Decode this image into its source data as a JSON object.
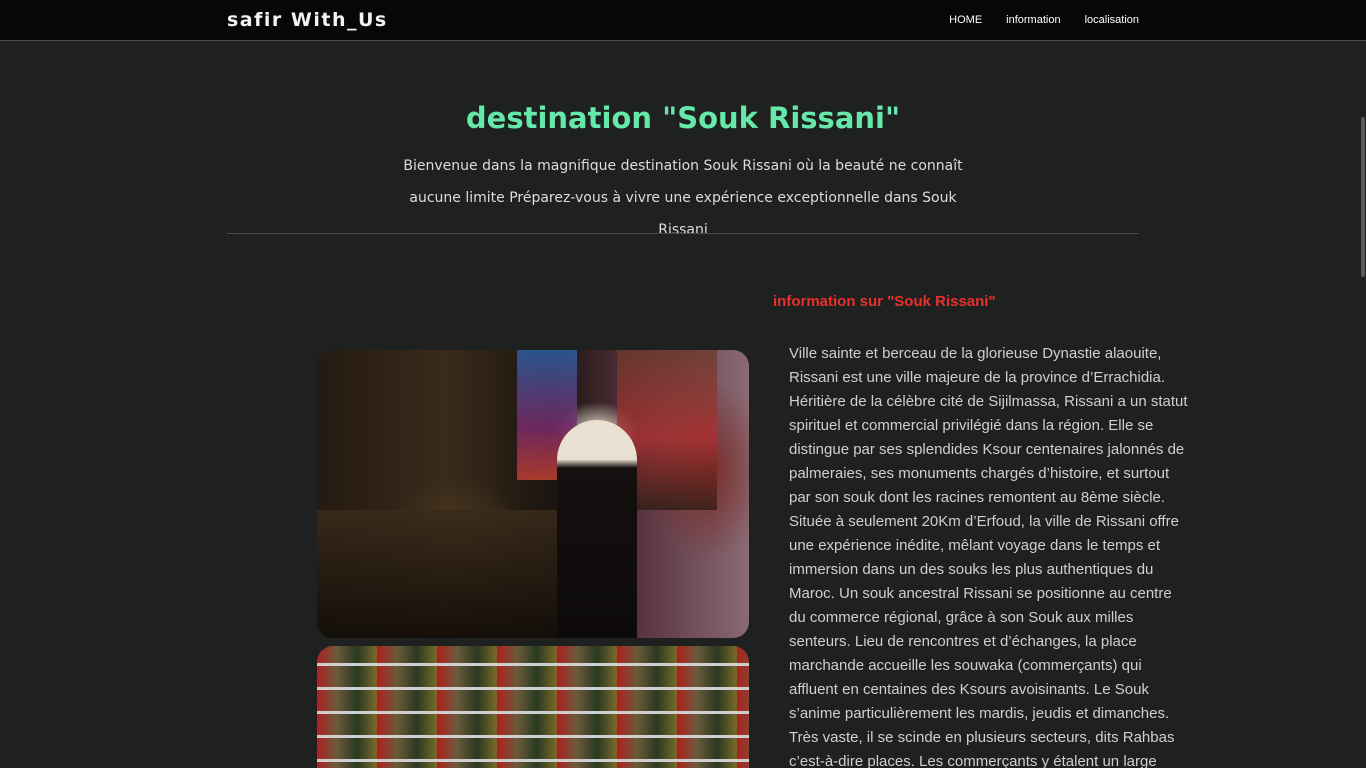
{
  "navbar": {
    "brand": "safir With_Us",
    "links": [
      "HOME",
      "information",
      "localisation"
    ]
  },
  "hero": {
    "title": "destination \"Souk Rissani\"",
    "description": "Bienvenue dans la magnifique destination Souk Rissani où la beauté ne connaît aucune limite Préparez-vous à vivre une expérience exceptionnelle dans Souk Rissani"
  },
  "info": {
    "heading": "information sur \"Souk Rissani\"",
    "text": "Ville sainte et berceau de la glorieuse Dynastie alaouite, Rissani est une ville majeure de la province d’Errachidia. Héritière de la célèbre cité de Sijilmassa, Rissani a un statut spirituel et commercial privilégié dans la région. Elle se distingue par ses splendides Ksour centenaires jalonnés de palmeraies, ses monuments chargés d’histoire, et surtout par son souk dont les racines remontent au 8ème siècle. Située à seulement 20Km d’Erfoud, la ville de Rissani offre une expérience inédite, mêlant voyage dans le temps et immersion dans un des souks les plus authentiques du Maroc. Un souk ancestral Rissani se positionne au centre du commerce régional, grâce à son Souk aux milles senteurs. Lieu de rencontres et d’échanges, la place marchande accueille les souwaka (commerçants) qui affluent en centaines des Ksours avoisinants. Le Souk s’anime particulièrement les mardis, jeudis et dimanches. Très vaste, il se scinde en plusieurs secteurs, dits Rahbas c’est-à-dire places. Les commerçants y étalent un large"
  },
  "colors": {
    "background": "#1f2120",
    "navbar": "#070707",
    "title_accent": "#66e8a9",
    "heading_red": "#e8312b"
  }
}
